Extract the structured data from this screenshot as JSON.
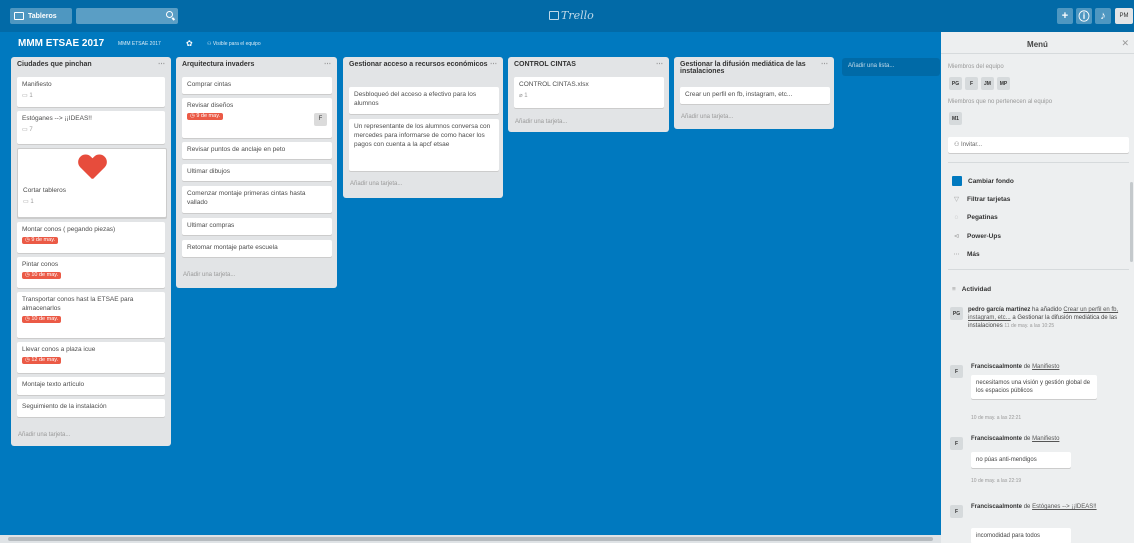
{
  "header": {
    "boards_label": "Tableros",
    "logo_text": "Trello",
    "user_initials": "PM"
  },
  "board": {
    "title": "MMM ETSAE 2017",
    "org": "MMM ETSAE 2017",
    "visibility": "Visible para el equipo"
  },
  "lists": [
    {
      "title": "Ciudades que pinchan",
      "cards": [
        {
          "title": "Manifiesto",
          "comments": "1"
        },
        {
          "title": "Estóganes --> ¡¡IDEAS!!",
          "comments": "7"
        },
        {
          "title": "Cortar tableros",
          "comments": "1"
        },
        {
          "title": "Montar conos ( pegando piezas)",
          "due": "9 de may."
        },
        {
          "title": "Pintar conos",
          "due": "10 de may."
        },
        {
          "title": "Transportar conos hast la ETSAE para almacenarlos",
          "due": "10 de may."
        },
        {
          "title": "Llevar conos a plaza icue",
          "due": "12 de may."
        },
        {
          "title": "Montaje texto artículo"
        },
        {
          "title": "Seguimiento de la instalación"
        }
      ],
      "add_card": "Añadir una tarjeta..."
    },
    {
      "title": "Arquitectura invaders",
      "cards": [
        {
          "title": "Comprar cintas"
        },
        {
          "title": "Revisar diseños",
          "due": "9 de may.",
          "member": "F"
        },
        {
          "title": "Revisar puntos de anclaje en peto"
        },
        {
          "title": "Ultimar dibujos"
        },
        {
          "title": "Comenzar montaje primeras cintas hasta vallado"
        },
        {
          "title": "Ultimar compras"
        },
        {
          "title": "Retomar montaje parte escuela"
        }
      ],
      "add_card": "Añadir una tarjeta..."
    },
    {
      "title": "Gestionar acceso a recursos económicos",
      "cards": [
        {
          "title": "Desbloqueó del acceso a efectivo para los alumnos"
        },
        {
          "title": "Un representante de los alumnos conversa con mercedes para informarse de como hacer los pagos con cuenta a la apcf etsae"
        }
      ],
      "add_card": "Añadir una tarjeta..."
    },
    {
      "title": "CONTROL CINTAS",
      "cards": [
        {
          "title": "CONTROL CINTAS.xlsx",
          "attachments": "1"
        }
      ],
      "add_card": "Añadir una tarjeta..."
    },
    {
      "title": "Gestionar la difusión mediática de las instalaciones",
      "cards": [
        {
          "title": "Crear un perfil en fb, instagram, etc..."
        }
      ],
      "add_card": "Añadir una tarjeta..."
    }
  ],
  "add_list": "Añadir una lista...",
  "menu": {
    "title": "Menú",
    "members_label": "Miembros del equipo",
    "members": [
      "PG",
      "F",
      "JM",
      "MP"
    ],
    "non_members_label": "Miembros que no pertenecen al equipo",
    "non_members": [
      "M1"
    ],
    "invite": "Invitar...",
    "items": [
      {
        "label": "Cambiar fondo",
        "icon": "color-swatch-icon"
      },
      {
        "label": "Filtrar tarjetas",
        "icon": "filter-icon"
      },
      {
        "label": "Pegatinas",
        "icon": "sticker-icon"
      },
      {
        "label": "Power-Ups",
        "icon": "power-up-icon"
      },
      {
        "label": "Más",
        "icon": "more-icon"
      }
    ],
    "activity_label": "Actividad",
    "activity": [
      {
        "avatar": "PG",
        "user": "pedro garcía martínez",
        "action": "ha añadido",
        "link": "Crear un perfil en fb, instagram, etc...",
        "rest": "a Gestionar la difusión mediática de las instalaciones",
        "time": "11 de may. a las 10:25"
      },
      {
        "avatar": "F",
        "user": "Franciscaalmonte",
        "prep": "de",
        "link": "Manifiesto",
        "comment": "necesitamos una visión y gestión global de los espacios públicos",
        "time": "10 de may. a las 22:21"
      },
      {
        "avatar": "F",
        "user": "Franciscaalmonte",
        "prep": "de",
        "link": "Manifiesto",
        "comment": "no púas anti-mendigos",
        "time": "10 de may. a las 22:19"
      },
      {
        "avatar": "F",
        "user": "Franciscaalmonte",
        "prep": "de",
        "link": "Estóganes --> ¡¡IDEAS!!",
        "comment": "incomodidad para todos"
      }
    ]
  }
}
